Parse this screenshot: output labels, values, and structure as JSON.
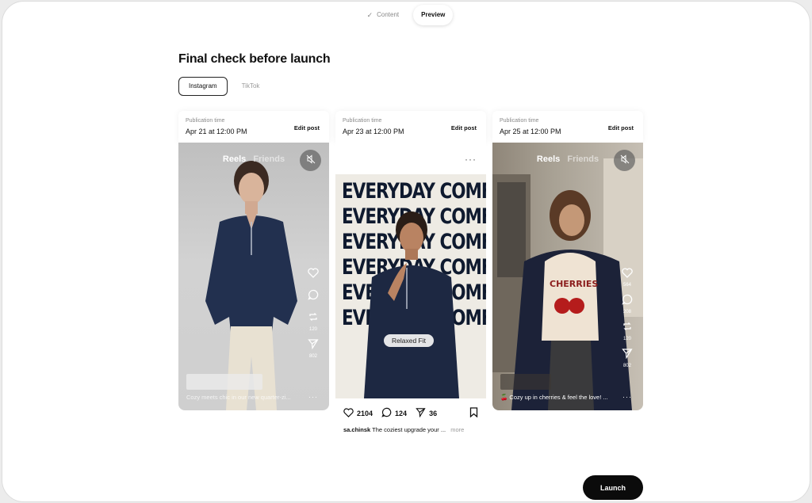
{
  "steps": [
    {
      "label": "Content",
      "state": "done"
    },
    {
      "label": "Preview",
      "state": "active"
    }
  ],
  "page_title": "Final check before launch",
  "platform_tabs": [
    {
      "label": "Instagram",
      "active": true
    },
    {
      "label": "TikTok",
      "active": false
    }
  ],
  "posts": [
    {
      "publication_label": "Publication time",
      "publication_time": "Apr 21 at 12:00 PM",
      "edit_label": "Edit post",
      "format": "reel",
      "reel_tabs": [
        "Reels",
        "Friends"
      ],
      "caption": "Cozy meets chic in our new quarter-zi...",
      "actions": [
        {
          "icon": "heart-icon",
          "count": ""
        },
        {
          "icon": "comment-icon",
          "count": ""
        },
        {
          "icon": "repost-icon",
          "count": "120"
        },
        {
          "icon": "send-icon",
          "count": "802"
        }
      ]
    },
    {
      "publication_label": "Publication time",
      "publication_time": "Apr 23 at 12:00 PM",
      "edit_label": "Edit post",
      "format": "feed-post",
      "headline": "EVERYDAY COMFORT",
      "badge": "Relaxed Fit",
      "likes": "2104",
      "comments": "124",
      "shares": "36",
      "username": "sa.chinsk",
      "caption": "The coziest upgrade your ...",
      "more_label": "more"
    },
    {
      "publication_label": "Publication time",
      "publication_time": "Apr 25 at 12:00 PM",
      "edit_label": "Edit post",
      "format": "reel",
      "reel_tabs": [
        "Reels",
        "Friends"
      ],
      "caption": "🍒 Cozy up in cherries & feel the love! ...",
      "actions": [
        {
          "icon": "heart-icon",
          "count": "564"
        },
        {
          "icon": "comment-icon",
          "count": "208"
        },
        {
          "icon": "repost-icon",
          "count": "120"
        },
        {
          "icon": "send-icon",
          "count": "802"
        }
      ]
    }
  ],
  "launch_label": "Launch",
  "colors": {
    "primary": "#0b0b0b",
    "muted": "#8a8a8a",
    "headline": "#0f1a2f"
  }
}
